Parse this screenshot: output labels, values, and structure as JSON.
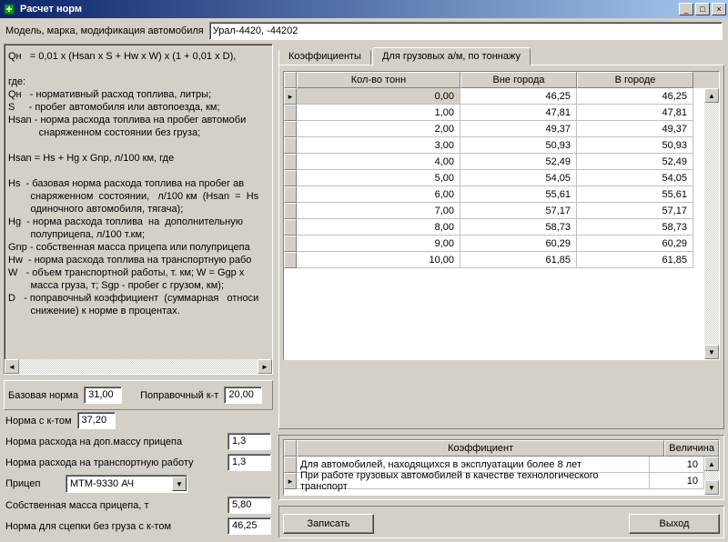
{
  "window": {
    "title": "Расчет норм"
  },
  "header": {
    "model_label": "Модель, марка, модификация автомобиля",
    "model_value": "Урал-4420, -44202"
  },
  "formula": {
    "text": "Qн   = 0,01 x (Hsan x S + Hw x W) x (1 + 0,01 x D),\n\nгде:\nQн   - нормативный расход топлива, литры;\nS     - пробег автомобиля или автопоезда, км;\nHsan - норма расхода топлива на пробег автомоби\n           снаряженном состоянии без груза;\n\nHsan = Hs + Hg x Gnp, л/100 км, где\n\nHs  - базовая норма расхода топлива на пробег ав\n        снаряженном  состоянии,   л/100 км  (Hsan  =  Hs\n        одиночного автомобиля, тягача);\nHg  - норма расхода топлива  на  дополнительную\n        полуприцепа, л/100 т.км;\nGnp - собственная масса прицепа или полуприцепа\nHw  - норма расхода топлива на транспортную рабо\nW   - объем транспортной работы, т. км; W = Ggp x\n        масcа груза, т; Sgp - пробег с грузом, км);\nD   - поправочный коэффициент  (суммарная   относи\n        снижение) к норме в процентах."
  },
  "params": {
    "base_label": "Базовая норма",
    "base_value": "31,00",
    "corr_label": "Поправочный к-т",
    "corr_value": "20,00",
    "norm_k_label": "Норма с к-том",
    "norm_k_value": "37,20",
    "extra_mass_label": "Норма расхода на доп.массу прицепа",
    "extra_mass_value": "1,3",
    "transport_label": "Норма расхода на транспортную работу",
    "transport_value": "1,3",
    "trailer_label": "Прицеп",
    "trailer_value": "МТМ-9330 АЧ",
    "own_mass_label": "Собственная масса прицепа, т",
    "own_mass_value": "5,80",
    "hitch_label": "Норма для сцепки без груза с к-том",
    "hitch_value": "46,25"
  },
  "tabs": {
    "t1": "Коэффициенты",
    "t2": "Для грузовых а/м, по тоннажу"
  },
  "grid": {
    "h1": "Кол-во тонн",
    "h2": "Вне города",
    "h3": "В городе",
    "rows": [
      {
        "a": "0,00",
        "b": "46,25",
        "c": "46,25"
      },
      {
        "a": "1,00",
        "b": "47,81",
        "c": "47,81"
      },
      {
        "a": "2,00",
        "b": "49,37",
        "c": "49,37"
      },
      {
        "a": "3,00",
        "b": "50,93",
        "c": "50,93"
      },
      {
        "a": "4,00",
        "b": "52,49",
        "c": "52,49"
      },
      {
        "a": "5,00",
        "b": "54,05",
        "c": "54,05"
      },
      {
        "a": "6,00",
        "b": "55,61",
        "c": "55,61"
      },
      {
        "a": "7,00",
        "b": "57,17",
        "c": "57,17"
      },
      {
        "a": "8,00",
        "b": "58,73",
        "c": "58,73"
      },
      {
        "a": "9,00",
        "b": "60,29",
        "c": "60,29"
      },
      {
        "a": "10,00",
        "b": "61,85",
        "c": "61,85"
      }
    ]
  },
  "coef_grid": {
    "h1": "Коэффициент",
    "h2": "Величина",
    "rows": [
      {
        "a": "Для автомобилей, находящихся в эксплуатации более 8 лет",
        "b": "10"
      },
      {
        "a": "При работе грузовых автомобилей в качестве технологического транспорт",
        "b": "10"
      }
    ]
  },
  "buttons": {
    "save": "Записать",
    "exit": "Выход"
  }
}
